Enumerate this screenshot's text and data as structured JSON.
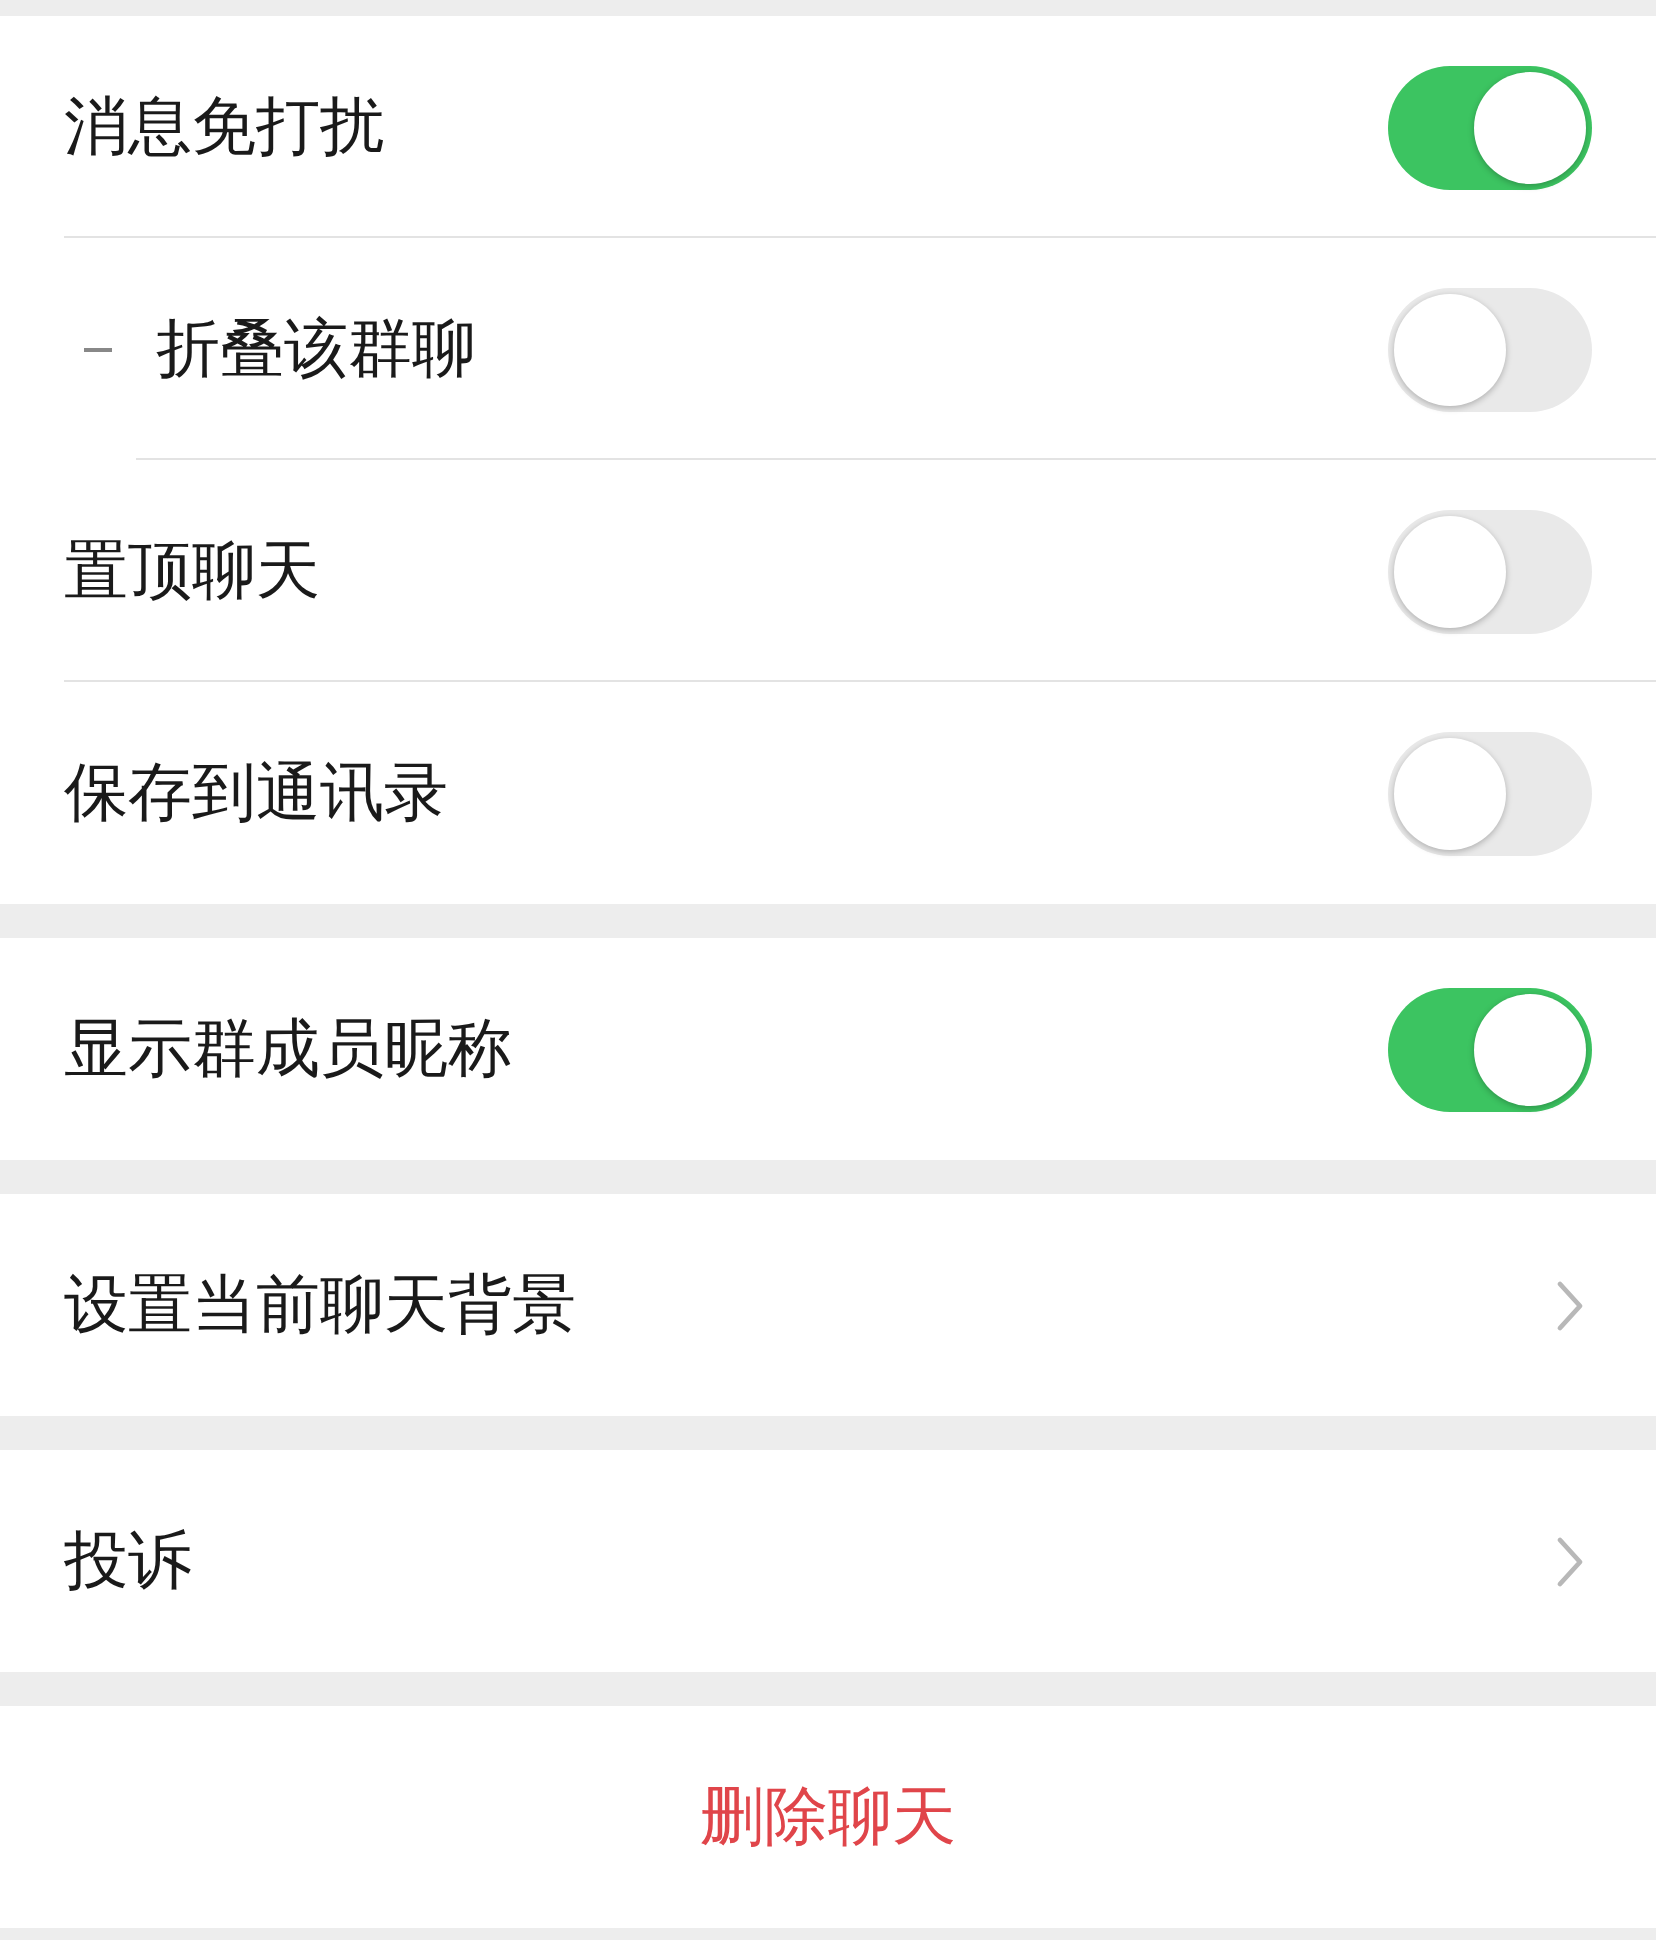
{
  "sections": [
    {
      "items": [
        {
          "kind": "toggle",
          "label": "消息免打扰",
          "on": true,
          "children": [
            {
              "kind": "toggle",
              "label": "折叠该群聊",
              "on": false
            }
          ]
        },
        {
          "kind": "toggle",
          "label": "置顶聊天",
          "on": false
        },
        {
          "kind": "toggle",
          "label": "保存到通讯录",
          "on": false
        }
      ]
    },
    {
      "items": [
        {
          "kind": "toggle",
          "label": "显示群成员昵称",
          "on": true
        }
      ]
    },
    {
      "items": [
        {
          "kind": "link",
          "label": "设置当前聊天背景"
        }
      ]
    },
    {
      "items": [
        {
          "kind": "link",
          "label": "投诉"
        }
      ]
    },
    {
      "items": [
        {
          "kind": "action",
          "label": "删除聊天"
        }
      ]
    }
  ]
}
